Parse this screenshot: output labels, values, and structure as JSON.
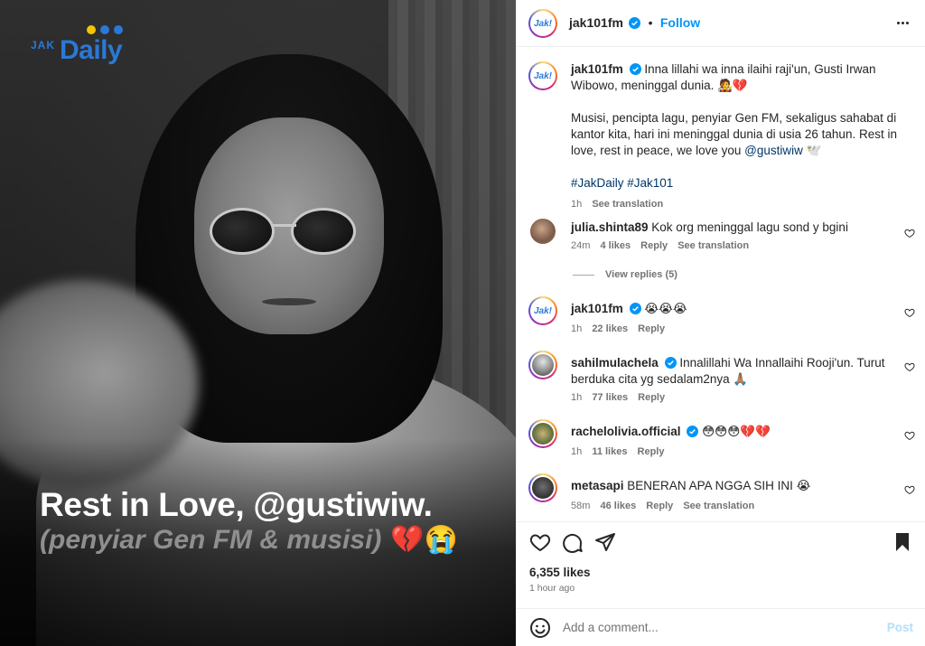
{
  "media": {
    "brand_small": "JAK",
    "brand_large": "Daily",
    "brand_dot_colors": [
      "#f5c400",
      "#2b78d6",
      "#2b78d6"
    ],
    "headline": "Rest in Love, @gustiwiw.",
    "subline": "(penyiar Gen FM & musisi)",
    "subline_emoji": "💔😭"
  },
  "header": {
    "username": "jak101fm",
    "separator": "•",
    "follow_label": "Follow",
    "avatar_logo": "Jak!"
  },
  "caption": {
    "username": "jak101fm",
    "line1": "Inna lillahi wa inna ilaihi raji'un, Gusti Irwan Wibowo, meninggal dunia. 🧑‍🎤💔",
    "paragraph2": "Musisi, pencipta lagu, penyiar Gen FM, sekaligus sahabat di kantor kita, hari ini meninggal dunia di usia 26 tahun. Rest in love, rest in peace, we love you ",
    "mention": "@gustiwiw",
    "paragraph2_tail": " 🕊️",
    "hashtags": "#JakDaily #Jak101",
    "time": "1h",
    "see_translation": "See translation"
  },
  "comments": [
    {
      "username": "julia.shinta89",
      "text": "Kok org meninggal lagu sond y bgini",
      "time": "24m",
      "likes": "4 likes",
      "reply": "Reply",
      "translate": "See translation"
    },
    {
      "username": "jak101fm",
      "text": "😭😭😭",
      "time": "1h",
      "likes": "22 likes",
      "reply": "Reply"
    },
    {
      "username": "sahilmulachela",
      "text": "Innalillahi Wa Innallaihi Rooji'un. Turut berduka cita yg sedalam2nya 🙏🏽",
      "time": "1h",
      "likes": "77 likes",
      "reply": "Reply"
    },
    {
      "username": "rachelolivia.official",
      "text": "😳😳😳💔💔",
      "time": "1h",
      "likes": "11 likes",
      "reply": "Reply"
    },
    {
      "username": "metasapi",
      "text": "BENERAN APA NGGA SIH INI 😭",
      "time": "58m",
      "likes": "46 likes",
      "reply": "Reply",
      "translate": "See translation"
    }
  ],
  "view_replies": "View replies (5)",
  "footer": {
    "likes": "6,355 likes",
    "ago": "1 hour ago",
    "add_comment_placeholder": "Add a comment...",
    "post_label": "Post"
  },
  "colors": {
    "link_blue": "#0095f6",
    "post_disabled": "#b2dffc",
    "verified": "#0095f6"
  },
  "icons": [
    "more-options-icon",
    "verified-icon",
    "heart-icon",
    "comment-icon",
    "share-icon",
    "bookmark-icon",
    "emoji-icon"
  ]
}
